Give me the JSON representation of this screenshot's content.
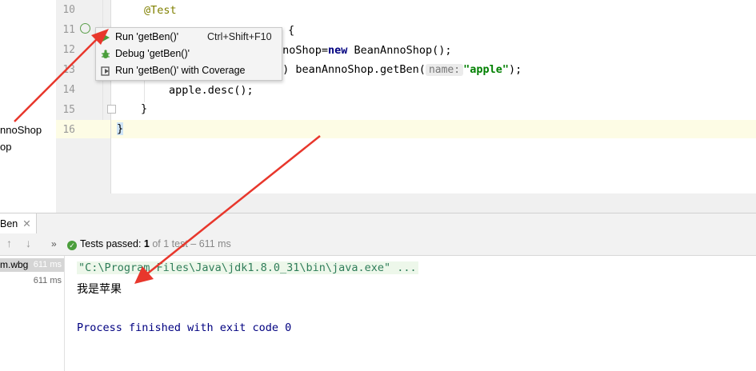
{
  "project_tree": {
    "items": [
      "nnoShop",
      "op"
    ]
  },
  "editor": {
    "line_numbers": [
      "10",
      "11",
      "12",
      "13",
      "14",
      "15",
      "16"
    ],
    "lines": {
      "l10_annotation": "@Test",
      "l12_before": "nnoShop=",
      "l12_kw": "new",
      "l12_after": " BeanAnnoShop();",
      "l13_before": "e) beanAnnoShop.getBen(",
      "l13_hint": "name:",
      "l13_string": "\"apple\"",
      "l13_after": ");",
      "l14": "apple.desc();",
      "l15": "}",
      "l16": "}"
    }
  },
  "context_menu": {
    "items": [
      {
        "label": "Run 'getBen()'",
        "shortcut": "Ctrl+Shift+F10",
        "icon": "run-icon"
      },
      {
        "label": "Debug 'getBen()'",
        "shortcut": "",
        "icon": "debug-icon"
      },
      {
        "label": "Run 'getBen()' with Coverage",
        "shortcut": "",
        "icon": "coverage-icon"
      }
    ]
  },
  "run_panel": {
    "tab_label": "Ben",
    "tests_passed_label": "Tests passed:",
    "tests_passed_count": "1",
    "tests_passed_detail": "of 1 test – 611 ms",
    "tree": {
      "row1_label": "m.wbg",
      "row1_time": "611 ms",
      "row2_time": "611 ms"
    },
    "console": {
      "command": "\"C:\\Program Files\\Java\\jdk1.8.0_31\\bin\\java.exe\" ...",
      "output": "我是苹果",
      "finish": "Process finished with exit code 0"
    }
  },
  "colors": {
    "annotation": "#808000",
    "keyword": "#000080",
    "string": "#008000",
    "arrow": "#e8372c",
    "pass_green": "#4b9e3c"
  }
}
